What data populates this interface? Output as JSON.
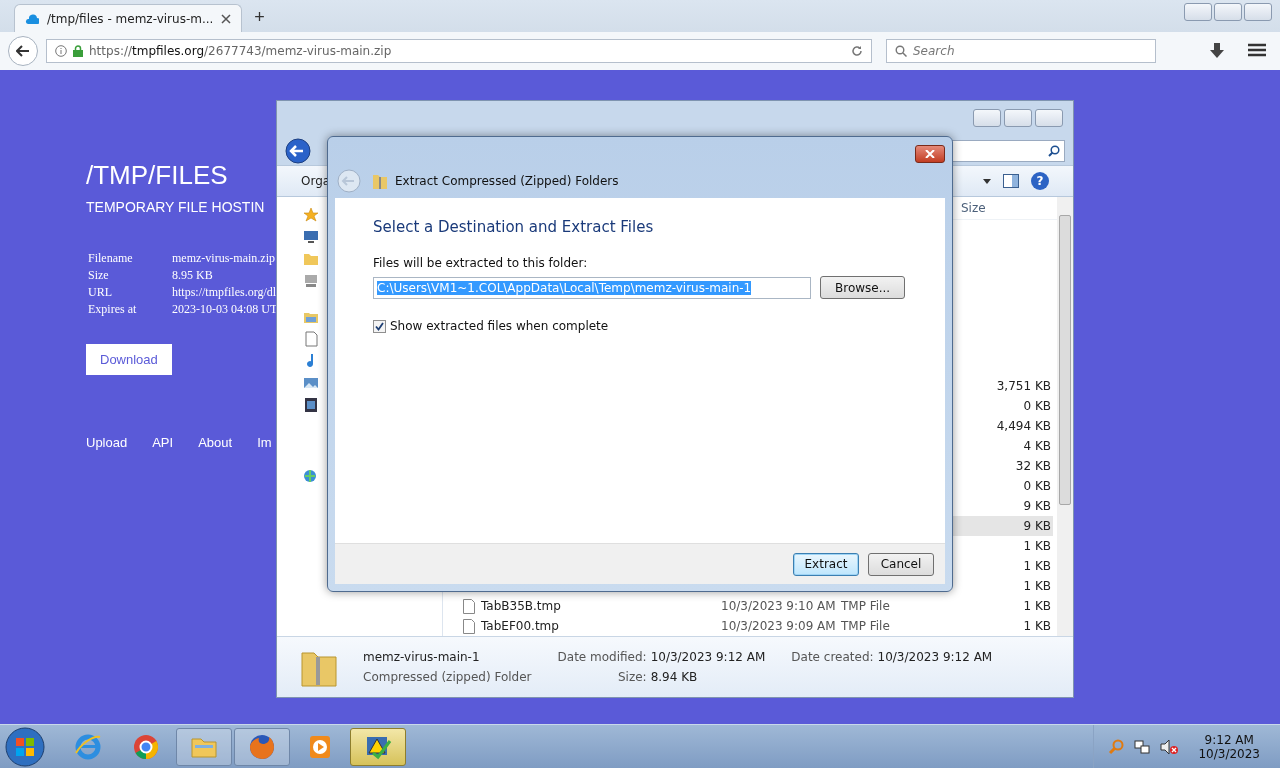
{
  "browser": {
    "tab_title": "/tmp/files - memz-virus-m...",
    "new_tab": "+",
    "url": {
      "scheme": "https://",
      "host": "tmpfiles.org",
      "path": "/2677743/memz-virus-main.zip"
    },
    "search_placeholder": "Search"
  },
  "page": {
    "title": "/TMP/FILES",
    "subtitle": "TEMPORARY FILE HOSTIN",
    "details": [
      {
        "label": "Filename",
        "value": "memz-virus-main.zip"
      },
      {
        "label": "Size",
        "value": "8.95 KB"
      },
      {
        "label": "URL",
        "value": "https://tmpfiles.org/dl"
      },
      {
        "label": "Expires at",
        "value": "2023-10-03 04:08 UT"
      }
    ],
    "download_button": "Download",
    "footer_links": [
      "Upload",
      "API",
      "About",
      "Im"
    ]
  },
  "explorer": {
    "toolbar_label": "Orga",
    "help_label": "?",
    "size_header": "Size",
    "rows": [
      {
        "size": "3,751 KB",
        "selected": false
      },
      {
        "size": "0 KB",
        "selected": false
      },
      {
        "size": "4,494 KB",
        "selected": false
      },
      {
        "size": "4 KB",
        "selected": false
      },
      {
        "size": "32 KB",
        "selected": false
      },
      {
        "size": "0 KB",
        "selected": false
      },
      {
        "size": "9 KB",
        "selected": false
      },
      {
        "size": "9 KB",
        "selected": true
      },
      {
        "size": "1 KB",
        "selected": false
      },
      {
        "size": "1 KB",
        "selected": false
      },
      {
        "size": "1 KB",
        "selected": false
      },
      {
        "name": "TabB35B.tmp",
        "date": "10/3/2023 9:10 AM",
        "type": "TMP File",
        "size": "1 KB",
        "selected": false
      },
      {
        "name": "TabEF00.tmp",
        "date": "10/3/2023 9:09 AM",
        "type": "TMP File",
        "size": "1 KB",
        "selected": false
      }
    ],
    "details": {
      "name": "memz-virus-main-1",
      "type": "Compressed (zipped) Folder",
      "fields": [
        {
          "label": "Date modified:",
          "value": "10/3/2023 9:12 AM"
        },
        {
          "label": "Date created:",
          "value": "10/3/2023 9:12 AM"
        },
        {
          "label": "Size:",
          "value": "8.94 KB"
        }
      ]
    }
  },
  "dialog": {
    "title": "Extract Compressed (Zipped) Folders",
    "heading": "Select a Destination and Extract Files",
    "folder_label": "Files will be extracted to this folder:",
    "path": "C:\\Users\\VM1~1.COL\\AppData\\Local\\Temp\\memz-virus-main-1",
    "browse_button": "Browse...",
    "show_files": {
      "label": "Show extracted files when complete",
      "checked": true
    },
    "buttons": [
      {
        "label": "Extract",
        "default": true
      },
      {
        "label": "Cancel",
        "default": false
      }
    ]
  },
  "taskbar": {
    "apps": [
      {
        "kind": "ie",
        "running": false,
        "selected": false
      },
      {
        "kind": "chrome",
        "running": false,
        "selected": false
      },
      {
        "kind": "explorer",
        "running": true,
        "selected": false
      },
      {
        "kind": "firefox",
        "running": true,
        "selected": false
      },
      {
        "kind": "media",
        "running": false,
        "selected": false
      },
      {
        "kind": "warning",
        "running": true,
        "selected": true
      }
    ],
    "time": "9:12 AM",
    "date": "10/3/2023"
  }
}
